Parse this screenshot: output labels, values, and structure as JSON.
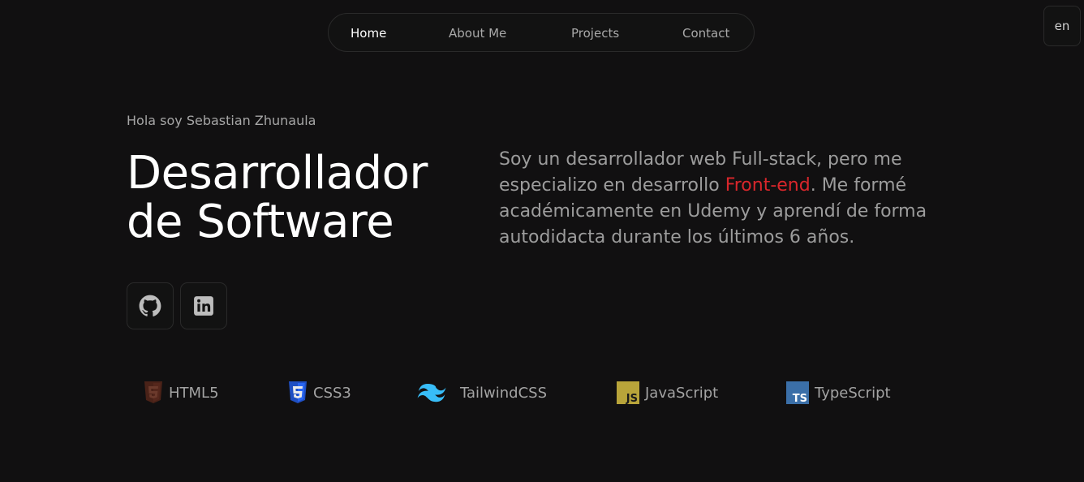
{
  "nav": {
    "items": [
      {
        "label": "Home",
        "active": true
      },
      {
        "label": "About Me",
        "active": false
      },
      {
        "label": "Projects",
        "active": false
      },
      {
        "label": "Contact",
        "active": false
      }
    ]
  },
  "lang": {
    "label": "en"
  },
  "hero": {
    "greeting": "Hola soy Sebastian Zhunaula",
    "headline_line1": "Desarrollador",
    "headline_line2": "de Software",
    "bio_part1": "Soy un desarrollador web Full-stack, pero me especializo en desarrollo ",
    "bio_highlight": "Front-end",
    "bio_part2": ". Me formé académicamente en Udemy y aprendí de forma autodidacta durante los últimos 6 años."
  },
  "social": [
    {
      "icon": "github-icon"
    },
    {
      "icon": "linkedin-icon"
    }
  ],
  "tech": [
    {
      "label": "HTML5",
      "icon": "html5-icon"
    },
    {
      "label": "CSS3",
      "icon": "css3-icon"
    },
    {
      "label": "TailwindCSS",
      "icon": "tailwind-icon"
    },
    {
      "label": "JavaScript",
      "icon": "javascript-icon"
    },
    {
      "label": "TypeScript",
      "icon": "typescript-icon"
    }
  ],
  "colors": {
    "background": "#111011",
    "accent": "#d9262b"
  }
}
